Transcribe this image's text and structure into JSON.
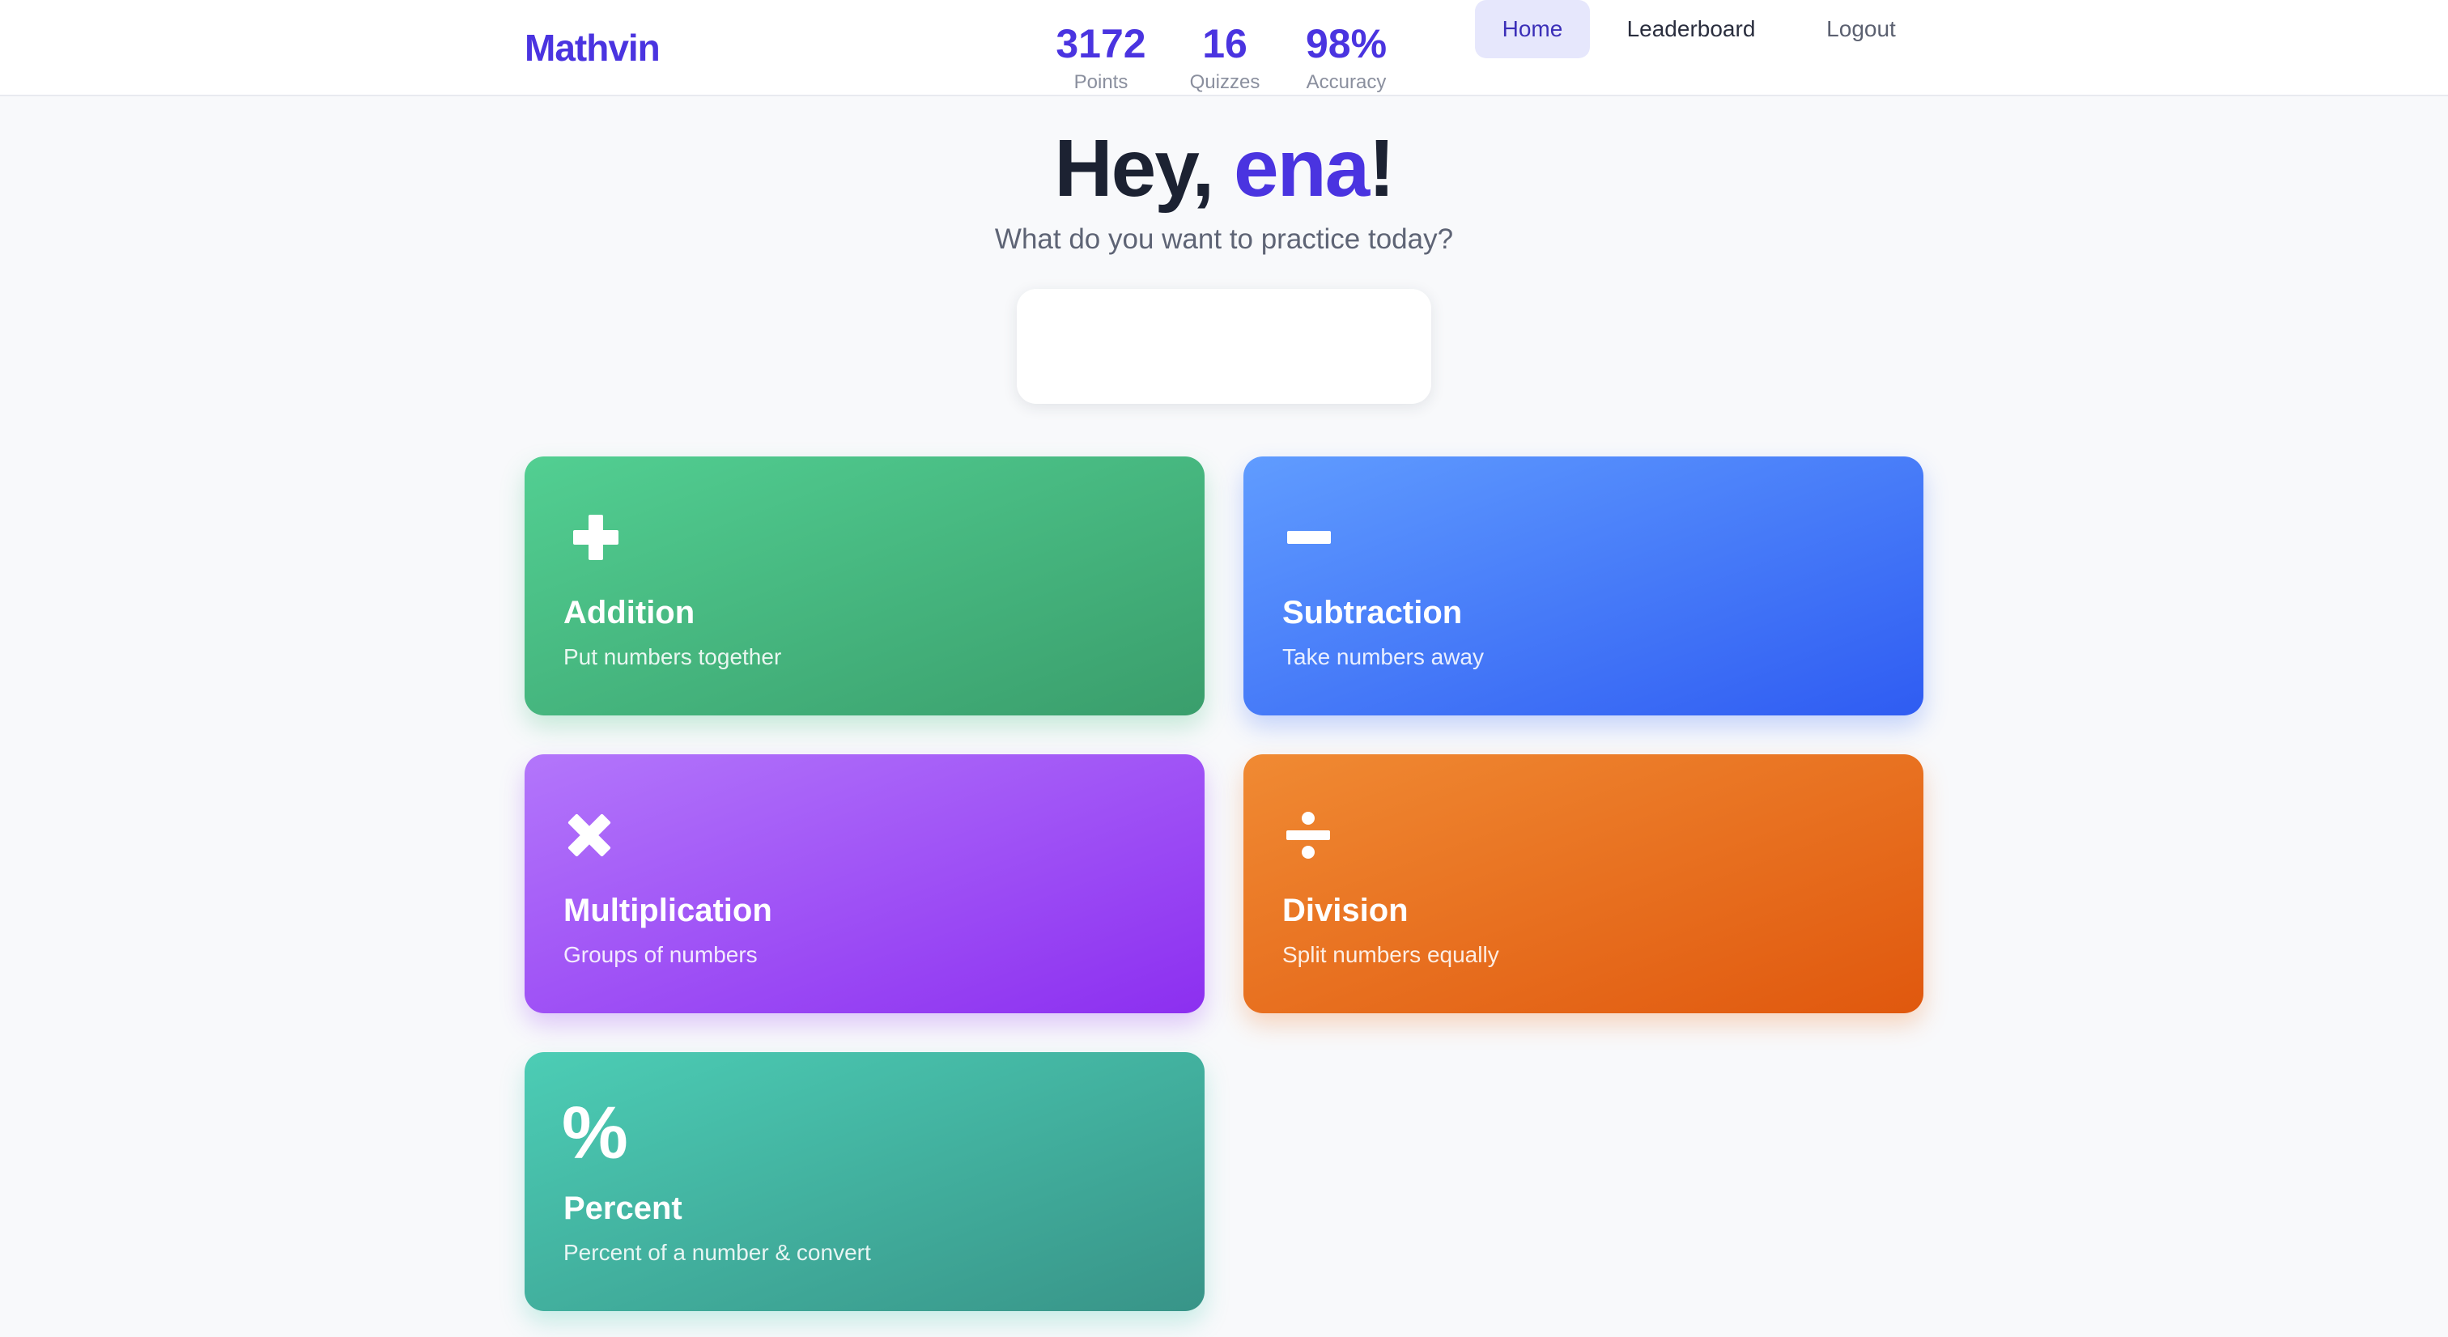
{
  "header": {
    "logo": "Mathvin",
    "nav": [
      {
        "label": "Home",
        "active": true
      },
      {
        "label": "Leaderboard",
        "active": false
      },
      {
        "label": "Logout",
        "active": false
      }
    ]
  },
  "greeting": {
    "prefix": "Hey, ",
    "name": "ena",
    "suffix": "!",
    "subtitle": "What do you want to practice today?"
  },
  "stats": [
    {
      "value": "3172",
      "label": "Points"
    },
    {
      "value": "16",
      "label": "Quizzes"
    },
    {
      "value": "98%",
      "label": "Accuracy"
    }
  ],
  "cards": [
    {
      "icon": "plus-icon",
      "title": "Addition",
      "description": "Put numbers together",
      "color": "#4cbf87"
    },
    {
      "icon": "minus-icon",
      "title": "Subtraction",
      "description": "Take numbers away",
      "color": "#4a7cfa"
    },
    {
      "icon": "times-icon",
      "title": "Multiplication",
      "description": "Groups of numbers",
      "color": "#a355f6"
    },
    {
      "icon": "divide-icon",
      "title": "Division",
      "description": "Split numbers equally",
      "color": "#e97122"
    },
    {
      "icon": "percent-icon",
      "title": "Percent",
      "description": "Percent of a number & convert",
      "color": "#43b0a0",
      "glyph": "%"
    }
  ],
  "colors": {
    "brand": "#4a34e0",
    "background": "#f8f9fb",
    "nav_active_bg": "#e6e7fc"
  }
}
